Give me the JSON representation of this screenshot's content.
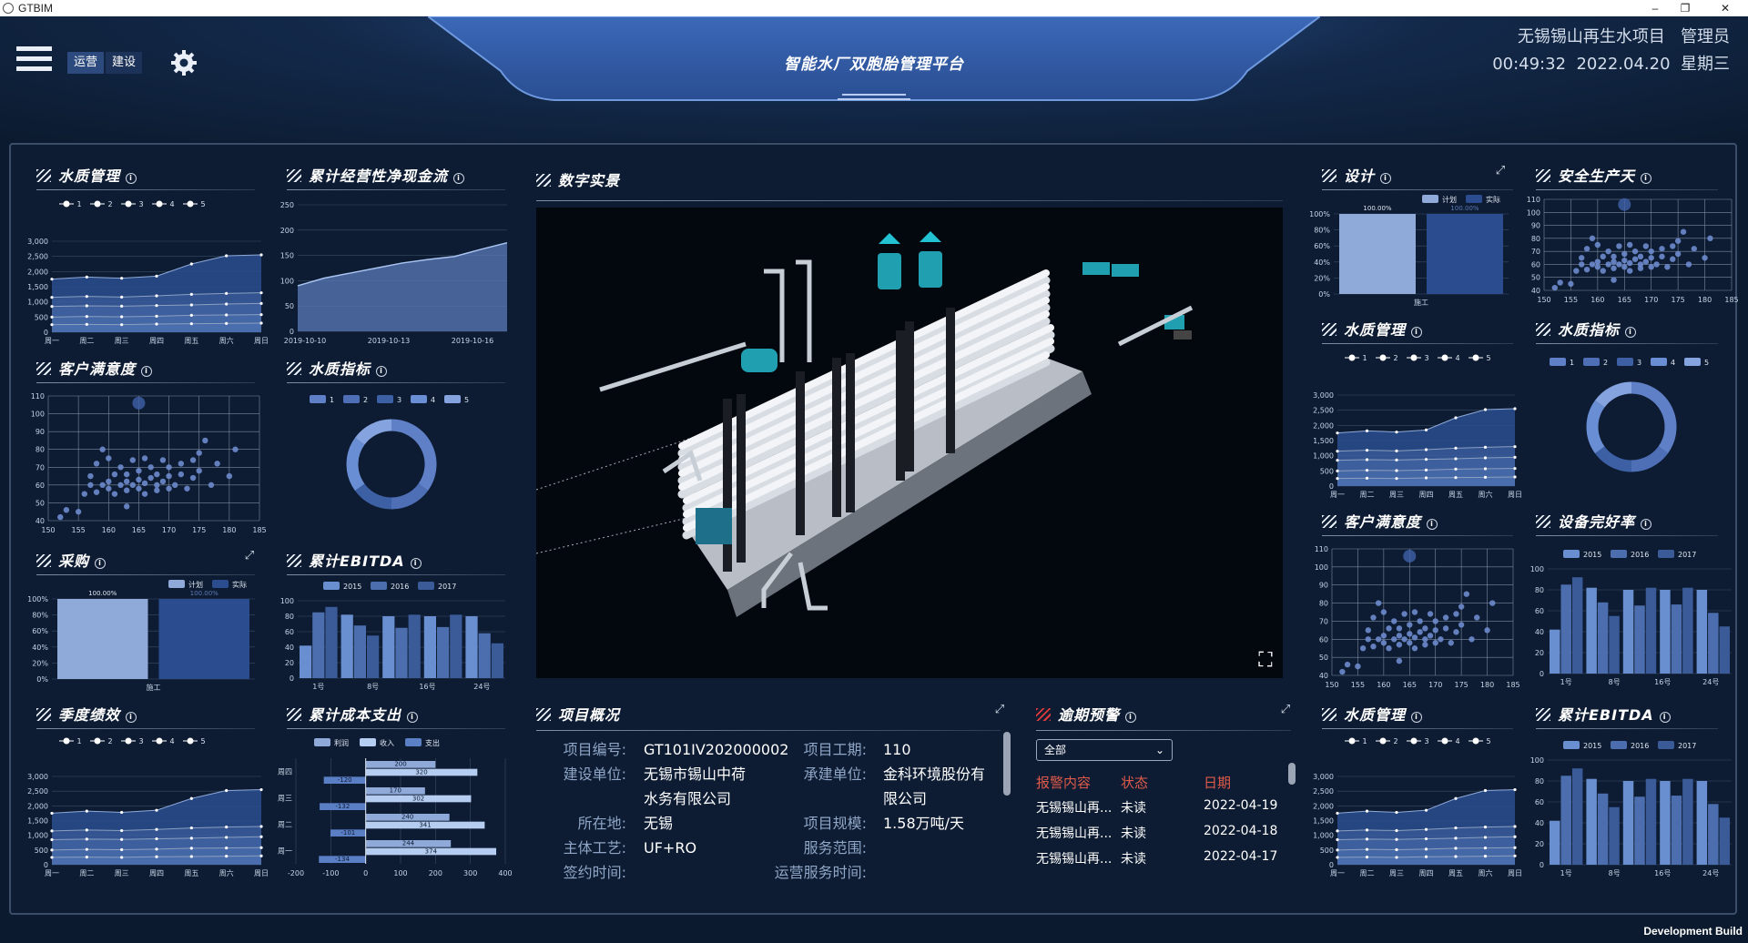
{
  "window": {
    "title": "GTBIM",
    "minimize": "–",
    "restore": "❐",
    "close": "✕"
  },
  "header": {
    "title": "智能水厂双胞胎管理平台",
    "tabs": [
      "运营",
      "建设"
    ],
    "project": "无锡锡山再生水项目",
    "user": "管理员",
    "time": "00:49:32",
    "date": "2022.04.20",
    "weekday": "星期三"
  },
  "colors": {
    "accent": "#5b7fc4",
    "light_blue": "#8fa9d8",
    "dark_blue": "#2b4d8f",
    "bg": "#0d1c33",
    "alert_red": "#e05a4a"
  },
  "panels": {
    "water_quality_mgmt": "水质管理",
    "net_cash_flow": "累计经营性净现金流",
    "customer_satisfaction": "客户满意度",
    "water_quality_index": "水质指标",
    "procurement": "采购",
    "ebitda": "累计EBITDA",
    "quarter_perf": "季度绩效",
    "cost_expense": "累计成本支出",
    "digital_scene": "数字实景",
    "design": "设计",
    "safety_days": "安全生产天",
    "equipment_rate": "设备完好率",
    "project_overview": "项目概况",
    "overdue_warning": "逾期预警"
  },
  "overview": {
    "labels": [
      "项目编号:",
      "建设单位:",
      "所在地:",
      "主体工艺:",
      "签约时间:"
    ],
    "values": [
      "GT101IV202000002",
      "无锡市锡山中荷",
      "水务有限公司",
      "无锡",
      "UF+RO"
    ],
    "labels2": [
      "项目工期:",
      "承建单位:",
      "项目规模:",
      "服务范围:",
      "运营服务时间:"
    ],
    "values2": [
      "110",
      "金科环境股份有",
      "限公司",
      "1.58万吨/天"
    ]
  },
  "alarms": {
    "filter": "全部",
    "headers": [
      "报警内容",
      "状态",
      "日期"
    ],
    "rows": [
      {
        "content": "无锡锡山再...",
        "status": "未读",
        "date": "2022-04-19"
      },
      {
        "content": "无锡锡山再...",
        "status": "未读",
        "date": "2022-04-18"
      },
      {
        "content": "无锡锡山再...",
        "status": "未读",
        "date": "2022-04-17"
      }
    ]
  },
  "footer": {
    "dev": "Development Build"
  },
  "chart_data": [
    {
      "id": "area_week",
      "type": "area",
      "legend": [
        "1",
        "2",
        "3",
        "4",
        "5"
      ],
      "categories": [
        "周一",
        "周二",
        "周三",
        "周四",
        "周五",
        "周六",
        "周日"
      ],
      "ylim": [
        0,
        3000
      ],
      "yticks": [
        "3,000",
        "2,500",
        "2,000",
        "1,500",
        "1,000",
        "500",
        "0"
      ],
      "series": [
        {
          "name": "5",
          "values": [
            1750,
            1820,
            1780,
            1850,
            2250,
            2520,
            2550
          ]
        },
        {
          "name": "4",
          "values": [
            1150,
            1180,
            1160,
            1200,
            1250,
            1280,
            1300
          ]
        },
        {
          "name": "3",
          "values": [
            850,
            870,
            860,
            880,
            900,
            930,
            950
          ]
        },
        {
          "name": "2",
          "values": [
            500,
            520,
            510,
            530,
            560,
            570,
            580
          ]
        },
        {
          "name": "1",
          "values": [
            250,
            260,
            250,
            270,
            280,
            290,
            300
          ]
        }
      ]
    },
    {
      "id": "cashflow",
      "type": "area",
      "categories": [
        "2019-10-10",
        "2019-10-13",
        "2019-10-16"
      ],
      "ylim": [
        0,
        250
      ],
      "yticks": [
        "250",
        "200",
        "150",
        "100",
        "50",
        "0"
      ],
      "x": [
        0,
        1,
        2,
        3,
        4,
        5,
        6,
        7,
        8
      ],
      "values": [
        90,
        105,
        115,
        125,
        135,
        142,
        148,
        162,
        175
      ]
    },
    {
      "id": "scatter",
      "type": "scatter",
      "xlim": [
        150,
        185
      ],
      "ylim": [
        40,
        110
      ],
      "xticks": [
        "150",
        "155",
        "160",
        "165",
        "170",
        "175",
        "180",
        "185"
      ],
      "yticks": [
        "110",
        "100",
        "90",
        "80",
        "70",
        "60",
        "50",
        "40"
      ],
      "points": [
        [
          152,
          42
        ],
        [
          153,
          46
        ],
        [
          155,
          45
        ],
        [
          156,
          55
        ],
        [
          157,
          60
        ],
        [
          157,
          65
        ],
        [
          158,
          56
        ],
        [
          158,
          72
        ],
        [
          159,
          60
        ],
        [
          160,
          58
        ],
        [
          160,
          62
        ],
        [
          160,
          75
        ],
        [
          161,
          66
        ],
        [
          161,
          55
        ],
        [
          162,
          60
        ],
        [
          162,
          70
        ],
        [
          163,
          62
        ],
        [
          163,
          57
        ],
        [
          163,
          66
        ],
        [
          164,
          74
        ],
        [
          164,
          60
        ],
        [
          165,
          63
        ],
        [
          165,
          68
        ],
        [
          165,
          58
        ],
        [
          166,
          61
        ],
        [
          166,
          75
        ],
        [
          166,
          55
        ],
        [
          167,
          64
        ],
        [
          167,
          70
        ],
        [
          168,
          60
        ],
        [
          168,
          66
        ],
        [
          168,
          57
        ],
        [
          169,
          62
        ],
        [
          169,
          74
        ],
        [
          170,
          65
        ],
        [
          170,
          58
        ],
        [
          170,
          70
        ],
        [
          171,
          60
        ],
        [
          172,
          66
        ],
        [
          172,
          72
        ],
        [
          173,
          58
        ],
        [
          174,
          74
        ],
        [
          174,
          64
        ],
        [
          175,
          78
        ],
        [
          175,
          68
        ],
        [
          176,
          85
        ],
        [
          177,
          60
        ],
        [
          178,
          72
        ],
        [
          180,
          65
        ],
        [
          181,
          80
        ],
        [
          159,
          80
        ],
        [
          163,
          48
        ]
      ],
      "bubble": [
        165,
        106
      ]
    },
    {
      "id": "donut",
      "type": "pie",
      "legend": [
        "1",
        "2",
        "3",
        "4",
        "5"
      ],
      "values": [
        35,
        15,
        15,
        20,
        15
      ]
    },
    {
      "id": "procure",
      "type": "bar",
      "legend": [
        "计划",
        "实际"
      ],
      "categories": [
        "施工"
      ],
      "ylim": [
        0,
        100
      ],
      "yticks": [
        "100%",
        "80%",
        "60%",
        "40%",
        "20%",
        "0%"
      ],
      "series": [
        {
          "name": "计划",
          "values": [
            100
          ]
        },
        {
          "name": "实际",
          "values": [
            100
          ]
        }
      ],
      "labels": [
        "100.00%",
        "100.00%"
      ]
    },
    {
      "id": "ebitda",
      "type": "bar",
      "legend": [
        "2015",
        "2016",
        "2017"
      ],
      "categories": [
        "1号",
        "8号",
        "16号",
        "24号"
      ],
      "ylim": [
        0,
        100
      ],
      "yticks": [
        "100",
        "80",
        "60",
        "40",
        "20",
        "0"
      ],
      "series": [
        {
          "name": "2015",
          "values": [
            42,
            82,
            80,
            80,
            80
          ]
        },
        {
          "name": "2016",
          "values": [
            85,
            68,
            65,
            66,
            58
          ]
        },
        {
          "name": "2017",
          "values": [
            92,
            55,
            82,
            82,
            45
          ]
        }
      ]
    },
    {
      "id": "cost",
      "type": "bar",
      "legend": [
        "利润",
        "收入",
        "支出"
      ],
      "categories": [
        "周一",
        "周二",
        "周三",
        "周四"
      ],
      "xlim": [
        -200,
        400
      ],
      "xticks": [
        "-200",
        "-100",
        "0",
        "100",
        "200",
        "300",
        "400"
      ],
      "series": [
        {
          "name": "利润",
          "values": [
            244,
            240,
            170,
            200
          ]
        },
        {
          "name": "收入",
          "values": [
            374,
            341,
            302,
            320
          ]
        },
        {
          "name": "支出",
          "values": [
            -134,
            -101,
            -132,
            -120
          ]
        }
      ]
    }
  ]
}
